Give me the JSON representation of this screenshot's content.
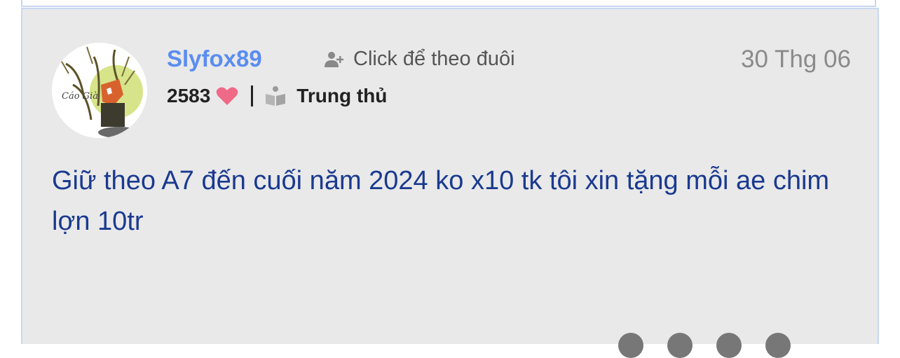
{
  "post": {
    "username": "Slyfox89",
    "follow_label": "Click để theo đuôi",
    "date": "30 Thg 06",
    "likes": "2583",
    "rank": "Trung thủ",
    "content": "Giữ theo A7 đến cuối năm 2024 ko x10 tk tôi xin tặng mỗi ae chim lợn 10tr",
    "avatar_text": "Cáo Già"
  },
  "colors": {
    "card_bg": "#e9e9ea",
    "card_border": "#c8d7f0",
    "username": "#5b8def",
    "content": "#1a3a8f",
    "heart": "#ee6a86",
    "date": "#8a8a8a"
  },
  "icons": {
    "follow": "add-user-icon",
    "likes": "heart-icon",
    "rank": "book-icon"
  }
}
